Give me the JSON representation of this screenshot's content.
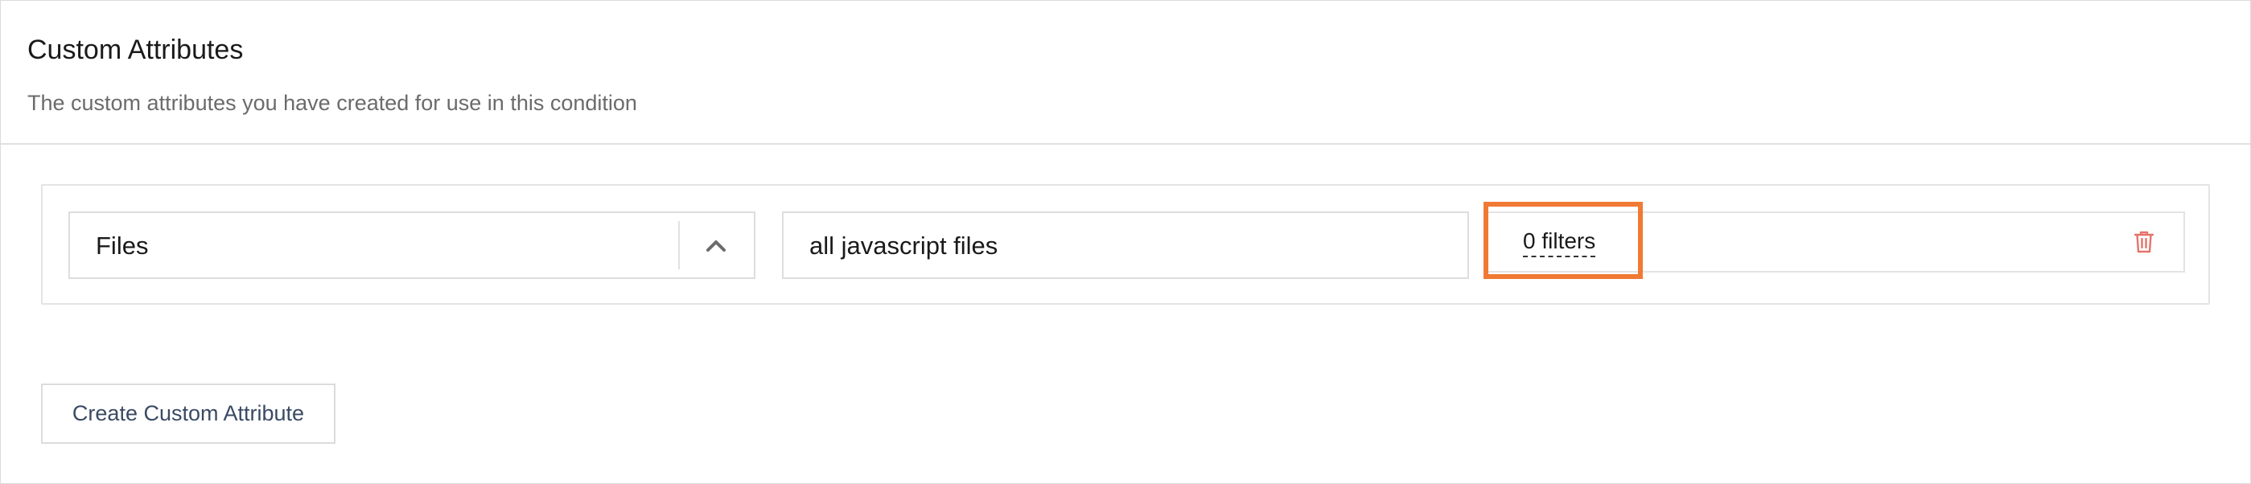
{
  "section": {
    "title": "Custom Attributes",
    "description": "The custom attributes you have created for use in this condition"
  },
  "attributes": [
    {
      "type": "Files",
      "name": "all javascript files",
      "filters_label": "0 filters"
    }
  ],
  "icons": {
    "type_toggle": "chevron-up-icon",
    "delete": "trash-icon"
  },
  "colors": {
    "highlight": "#f07a33",
    "delete_icon": "#e5736a"
  },
  "actions": {
    "create_label": "Create Custom Attribute"
  }
}
